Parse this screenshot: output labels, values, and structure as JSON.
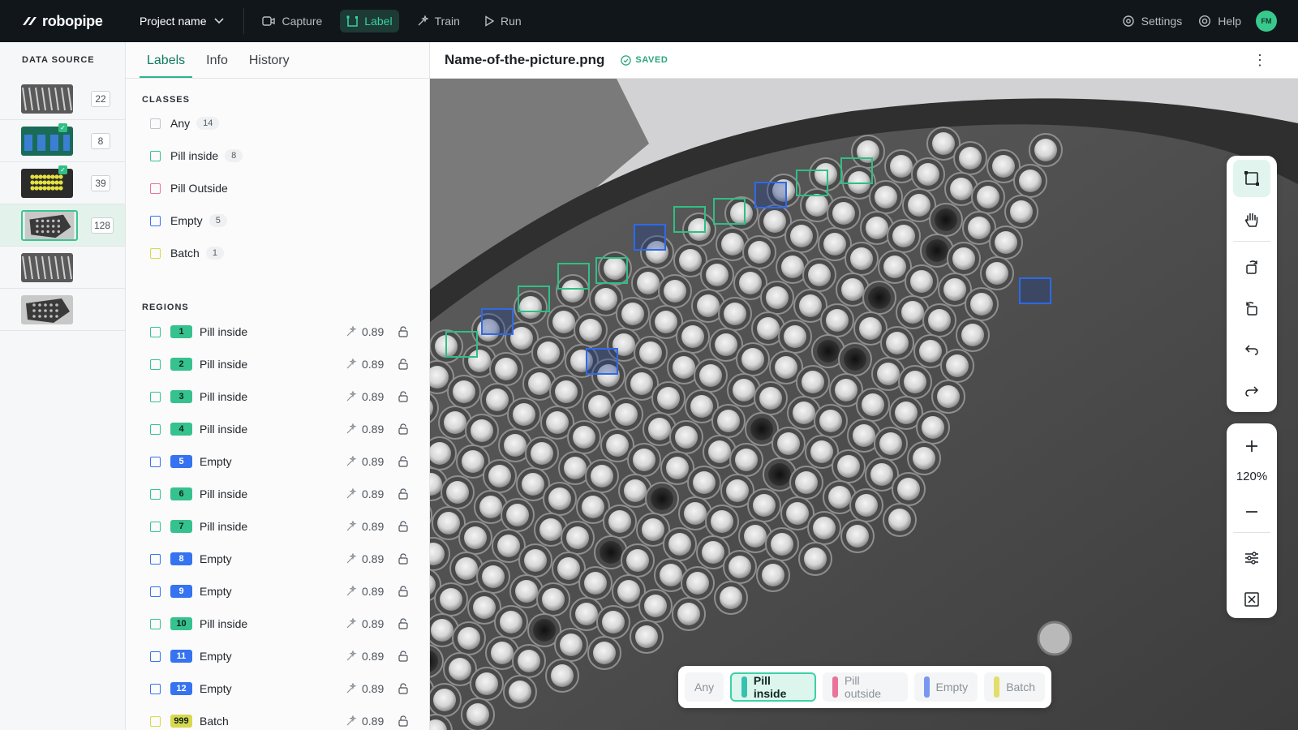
{
  "brand": {
    "name": "robopipe"
  },
  "topbar": {
    "project": "Project name",
    "nav": [
      {
        "label": "Capture",
        "icon": "video-icon",
        "active": false
      },
      {
        "label": "Label",
        "icon": "label-icon",
        "active": true
      },
      {
        "label": "Train",
        "icon": "sparkle-icon",
        "active": false
      },
      {
        "label": "Run",
        "icon": "play-icon",
        "active": false
      }
    ],
    "settings": "Settings",
    "help": "Help",
    "avatar": "FM"
  },
  "data_source": {
    "title": "DATA SOURCE",
    "items": [
      {
        "count": "22",
        "checked": false,
        "selected": false,
        "thumb": "tray-rows"
      },
      {
        "count": "8",
        "checked": true,
        "selected": false,
        "thumb": "blue-bottles"
      },
      {
        "count": "39",
        "checked": true,
        "selected": false,
        "thumb": "yellow-pills"
      },
      {
        "count": "128",
        "checked": false,
        "selected": true,
        "thumb": "pill-plate"
      },
      {
        "count": "",
        "checked": false,
        "selected": false,
        "thumb": "tray-rows"
      },
      {
        "count": "",
        "checked": false,
        "selected": false,
        "thumb": "pill-plate"
      }
    ]
  },
  "panel": {
    "tabs": [
      "Labels",
      "Info",
      "History"
    ],
    "classes_title": "CLASSES",
    "classes": [
      {
        "label": "Any",
        "count": "14",
        "color": "#bfc4c9"
      },
      {
        "label": "Pill inside",
        "count": "8",
        "color": "#36c28e"
      },
      {
        "label": "Pill Outside",
        "count": "",
        "color": "#e8739b"
      },
      {
        "label": "Empty",
        "count": "5",
        "color": "#3573f0"
      },
      {
        "label": "Batch",
        "count": "1",
        "color": "#d7d84e"
      }
    ],
    "regions_title": "REGIONS",
    "regions": [
      {
        "num": "1",
        "label": "Pill inside",
        "score": "0.89",
        "color": "#36c28e"
      },
      {
        "num": "2",
        "label": "Pill inside",
        "score": "0.89",
        "color": "#36c28e"
      },
      {
        "num": "3",
        "label": "Pill inside",
        "score": "0.89",
        "color": "#36c28e"
      },
      {
        "num": "4",
        "label": "Pill inside",
        "score": "0.89",
        "color": "#36c28e"
      },
      {
        "num": "5",
        "label": "Empty",
        "score": "0.89",
        "color": "#3573f0"
      },
      {
        "num": "6",
        "label": "Pill inside",
        "score": "0.89",
        "color": "#36c28e"
      },
      {
        "num": "7",
        "label": "Pill inside",
        "score": "0.89",
        "color": "#36c28e"
      },
      {
        "num": "8",
        "label": "Empty",
        "score": "0.89",
        "color": "#3573f0"
      },
      {
        "num": "9",
        "label": "Empty",
        "score": "0.89",
        "color": "#3573f0"
      },
      {
        "num": "10",
        "label": "Pill inside",
        "score": "0.89",
        "color": "#36c28e"
      },
      {
        "num": "11",
        "label": "Empty",
        "score": "0.89",
        "color": "#3573f0"
      },
      {
        "num": "12",
        "label": "Empty",
        "score": "0.89",
        "color": "#3573f0"
      },
      {
        "num": "999",
        "label": "Batch",
        "score": "0.89",
        "color": "#d7d84e"
      }
    ]
  },
  "file": {
    "name": "Name-of-the-picture.png",
    "status": "SAVED"
  },
  "zoom": {
    "label": "120%"
  },
  "picker": [
    {
      "label": "Any",
      "color": "",
      "active": false
    },
    {
      "label": "Pill inside",
      "color": "#36c2b0",
      "active": true
    },
    {
      "label": "Pill outside",
      "color": "#e8739b",
      "active": false
    },
    {
      "label": "Empty",
      "color": "#7a97f0",
      "active": false
    },
    {
      "label": "Batch",
      "color": "#e2de6b",
      "active": false
    }
  ],
  "annotation_boxes": [
    {
      "cls": "pill"
    },
    {
      "cls": "empty"
    },
    {
      "cls": "pill"
    },
    {
      "cls": "pill"
    },
    {
      "cls": "pill"
    },
    {
      "cls": "empty"
    },
    {
      "cls": "pill"
    },
    {
      "cls": "pill"
    },
    {
      "cls": "empty"
    },
    {
      "cls": "pill"
    },
    {
      "cls": "pill"
    },
    {
      "cls": "empty"
    },
    {
      "cls": "empty"
    }
  ]
}
